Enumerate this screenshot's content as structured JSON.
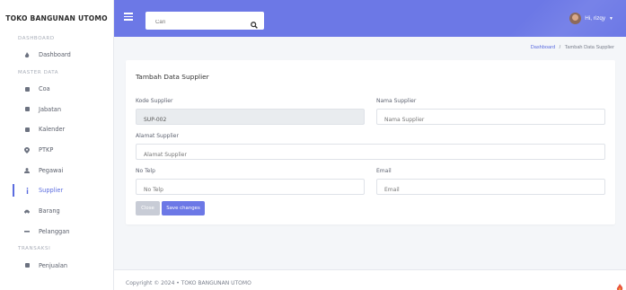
{
  "sidebar": {
    "brand": "TOKO BANGUNAN UTOMO",
    "sections": {
      "dashboard": "DASHBOARD",
      "master": "MASTER DATA",
      "transaksi": "TRANSAKSI"
    },
    "items": [
      {
        "label": "Dashboard",
        "icon": "fire-icon"
      },
      {
        "label": "Coa",
        "icon": "grid-icon"
      },
      {
        "label": "Jabatan",
        "icon": "grid-icon"
      },
      {
        "label": "Kalender",
        "icon": "grid-icon"
      },
      {
        "label": "PTKP",
        "icon": "pin-icon"
      },
      {
        "label": "Pegawai",
        "icon": "user-icon"
      },
      {
        "label": "Supplier",
        "icon": "info-icon",
        "active": true
      },
      {
        "label": "Barang",
        "icon": "car-icon"
      },
      {
        "label": "Pelanggan",
        "icon": "dash-icon"
      },
      {
        "label": "Penjualan",
        "icon": "grid-icon"
      }
    ]
  },
  "topbar": {
    "search_placeholder": "Cari",
    "user_name": "Hi, rizqy"
  },
  "breadcrumb": {
    "home": "Dashboard",
    "separator": "/",
    "current": "Tambah Data Supplier"
  },
  "form": {
    "title": "Tambah Data Supplier",
    "kode_label": "Kode Supplier",
    "kode_value": "SUP-002",
    "nama_label": "Nama Supplier",
    "nama_placeholder": "Nama Supplier",
    "alamat_label": "Alamat Supplier",
    "alamat_placeholder": "Alamat Supplier",
    "telp_label": "No Telp",
    "telp_placeholder": "No Telp",
    "email_label": "Email",
    "email_placeholder": "Email",
    "close_label": "Close",
    "save_label": "Save changes"
  },
  "footer": {
    "text": "Copyright © 2024  •  TOKO BANGUNAN UTOMO"
  },
  "colors": {
    "primary": "#6c78e6",
    "active": "#5b6cdf"
  }
}
